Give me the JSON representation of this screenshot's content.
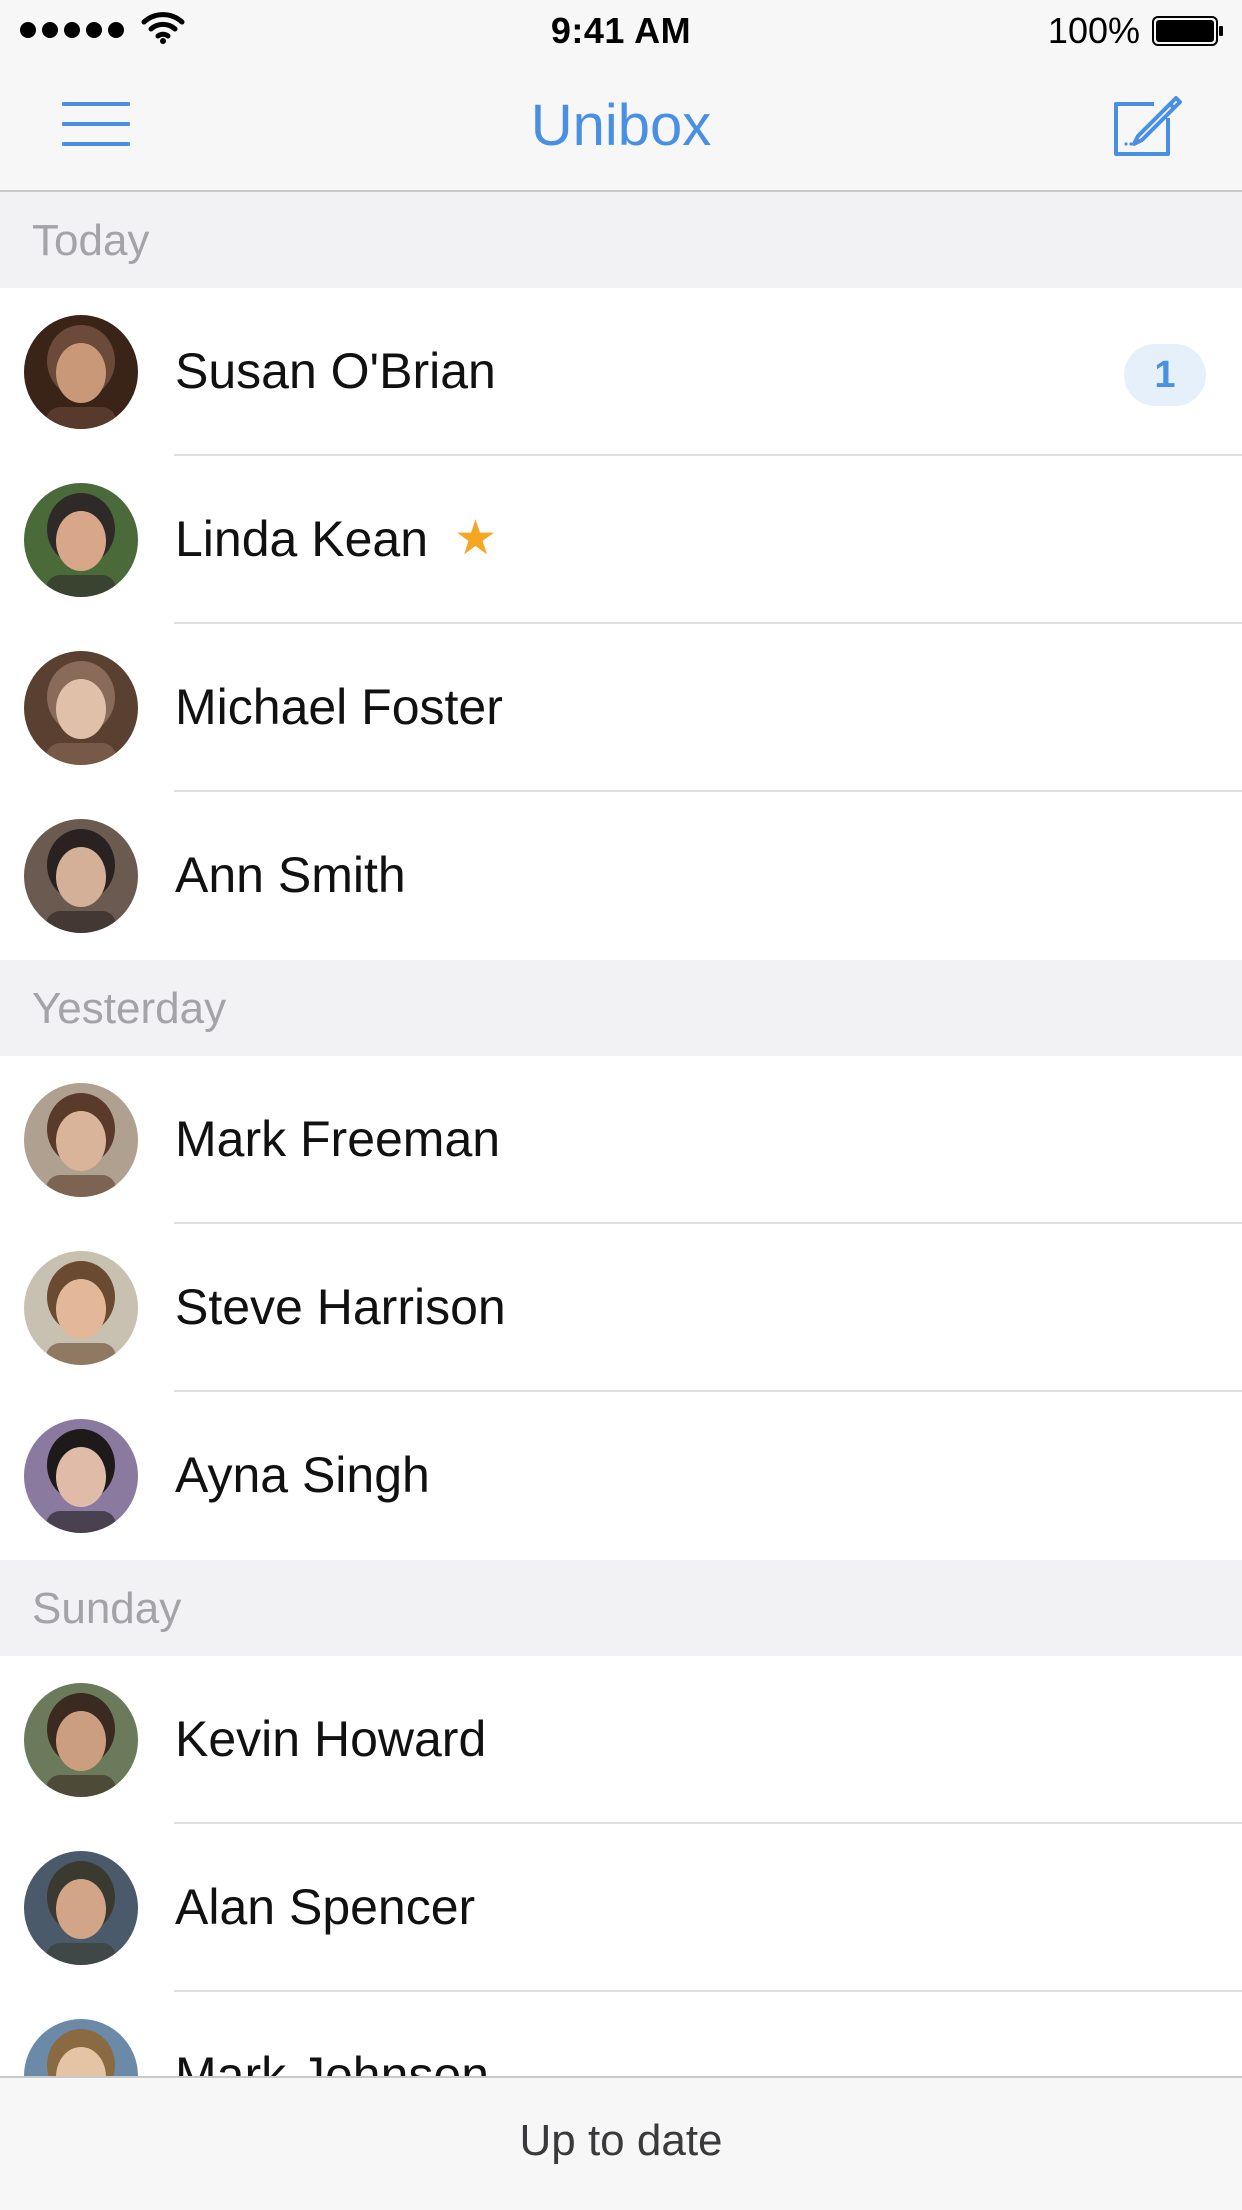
{
  "status_bar": {
    "time": "9:41 AM",
    "battery": "100%"
  },
  "nav": {
    "title": "Unibox"
  },
  "sections": [
    {
      "header": "Today",
      "rows": [
        {
          "name": "Susan O'Brian",
          "badge": "1",
          "starred": false
        },
        {
          "name": "Linda Kean",
          "badge": "",
          "starred": true
        },
        {
          "name": "Michael Foster",
          "badge": "",
          "starred": false
        },
        {
          "name": "Ann Smith",
          "badge": "",
          "starred": false
        }
      ]
    },
    {
      "header": "Yesterday",
      "rows": [
        {
          "name": "Mark Freeman",
          "badge": "",
          "starred": false
        },
        {
          "name": "Steve Harrison",
          "badge": "",
          "starred": false
        },
        {
          "name": "Ayna Singh",
          "badge": "",
          "starred": false
        }
      ]
    },
    {
      "header": "Sunday",
      "rows": [
        {
          "name": "Kevin Howard",
          "badge": "",
          "starred": false
        },
        {
          "name": "Alan Spencer",
          "badge": "",
          "starred": false
        },
        {
          "name": "Mark Johnson",
          "badge": "",
          "starred": false
        }
      ]
    }
  ],
  "toolbar": {
    "status": "Up to date"
  },
  "colors": {
    "accent": "#4a90e2",
    "star": "#f5a623",
    "section_bg": "#f2f2f4",
    "section_text": "#a3a3a8"
  },
  "icons": {
    "menu": "hamburger-icon",
    "compose": "compose-icon",
    "star": "star-icon"
  }
}
